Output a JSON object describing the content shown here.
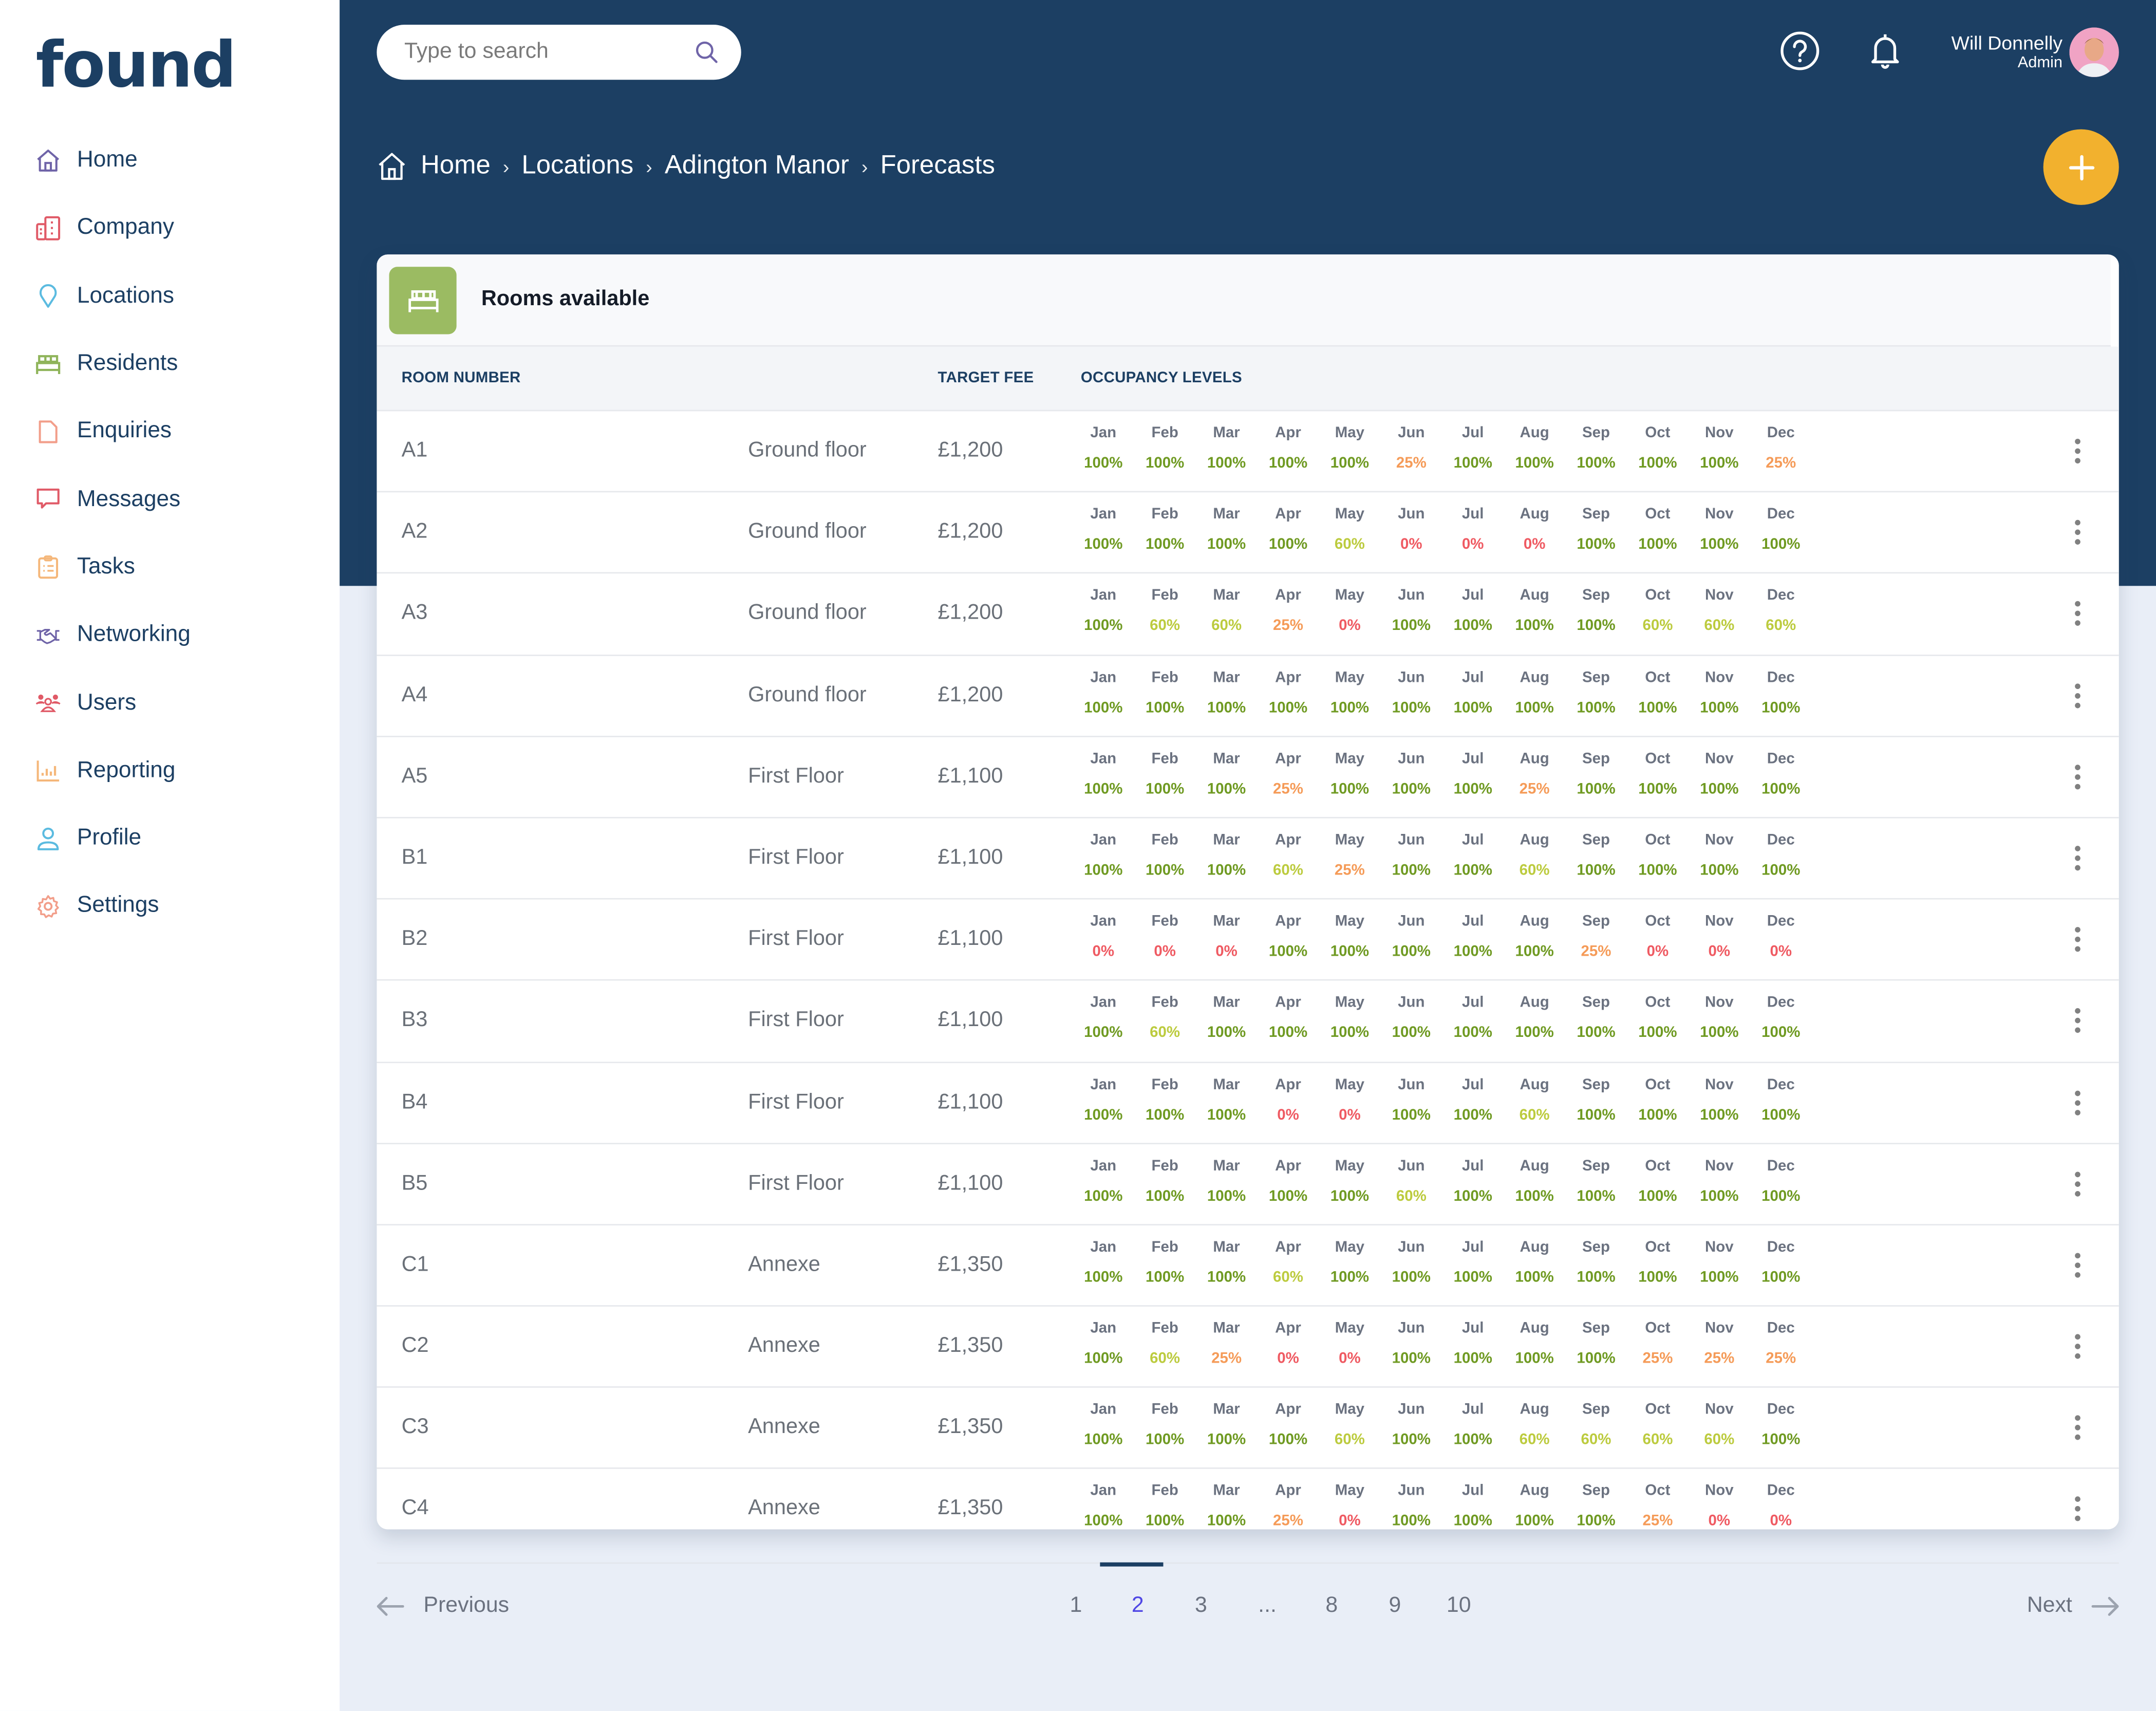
{
  "brand": {
    "logo": "found"
  },
  "sidebar": {
    "items": [
      {
        "label": "Home",
        "icon": "home-icon",
        "color": "#6f64a8"
      },
      {
        "label": "Company",
        "icon": "building-icon",
        "color": "#e05a67"
      },
      {
        "label": "Locations",
        "icon": "map-pin-icon",
        "color": "#5bbbe0"
      },
      {
        "label": "Residents",
        "icon": "bed-icon",
        "color": "#8fb45a"
      },
      {
        "label": "Enquiries",
        "icon": "document-icon",
        "color": "#f29e8a"
      },
      {
        "label": "Messages",
        "icon": "chat-icon",
        "color": "#e05a67"
      },
      {
        "label": "Tasks",
        "icon": "clipboard-icon",
        "color": "#f5b77a"
      },
      {
        "label": "Networking",
        "icon": "handshake-icon",
        "color": "#6f64a8"
      },
      {
        "label": "Users",
        "icon": "users-icon",
        "color": "#e05a67"
      },
      {
        "label": "Reporting",
        "icon": "bar-chart-icon",
        "color": "#f5b77a"
      },
      {
        "label": "Profile",
        "icon": "user-icon",
        "color": "#5bbbe0"
      },
      {
        "label": "Settings",
        "icon": "gear-icon",
        "color": "#f29e8a"
      }
    ]
  },
  "header": {
    "search_placeholder": "Type to search",
    "user_name": "Will Donnelly",
    "user_role": "Admin"
  },
  "breadcrumb": [
    "Home",
    "Locations",
    "Adington Manor",
    "Forecasts"
  ],
  "card": {
    "title": "Rooms available",
    "columns": {
      "room": "ROOM NUMBER",
      "fee": "TARGET FEE",
      "occupancy": "OCCUPANCY LEVELS"
    }
  },
  "months": [
    "Jan",
    "Feb",
    "Mar",
    "Apr",
    "May",
    "Jun",
    "Jul",
    "Aug",
    "Sep",
    "Oct",
    "Nov",
    "Dec"
  ],
  "level_colors": {
    "100%": "#6f9a22",
    "60%": "#bccb3e",
    "25%": "#f59b58",
    "0%": "#ef5a62"
  },
  "rooms": [
    {
      "room": "A1",
      "floor": "Ground floor",
      "fee": "£1,200",
      "occ": [
        "100%",
        "100%",
        "100%",
        "100%",
        "100%",
        "25%",
        "100%",
        "100%",
        "100%",
        "100%",
        "100%",
        "25%"
      ]
    },
    {
      "room": "A2",
      "floor": "Ground floor",
      "fee": "£1,200",
      "occ": [
        "100%",
        "100%",
        "100%",
        "100%",
        "60%",
        "0%",
        "0%",
        "0%",
        "100%",
        "100%",
        "100%",
        "100%"
      ]
    },
    {
      "room": "A3",
      "floor": "Ground floor",
      "fee": "£1,200",
      "occ": [
        "100%",
        "60%",
        "60%",
        "25%",
        "0%",
        "100%",
        "100%",
        "100%",
        "100%",
        "60%",
        "60%",
        "60%"
      ]
    },
    {
      "room": "A4",
      "floor": "Ground floor",
      "fee": "£1,200",
      "occ": [
        "100%",
        "100%",
        "100%",
        "100%",
        "100%",
        "100%",
        "100%",
        "100%",
        "100%",
        "100%",
        "100%",
        "100%"
      ]
    },
    {
      "room": "A5",
      "floor": "First Floor",
      "fee": "£1,100",
      "occ": [
        "100%",
        "100%",
        "100%",
        "25%",
        "100%",
        "100%",
        "100%",
        "25%",
        "100%",
        "100%",
        "100%",
        "100%"
      ]
    },
    {
      "room": "B1",
      "floor": "First Floor",
      "fee": "£1,100",
      "occ": [
        "100%",
        "100%",
        "100%",
        "60%",
        "25%",
        "100%",
        "100%",
        "60%",
        "100%",
        "100%",
        "100%",
        "100%"
      ]
    },
    {
      "room": "B2",
      "floor": "First Floor",
      "fee": "£1,100",
      "occ": [
        "0%",
        "0%",
        "0%",
        "100%",
        "100%",
        "100%",
        "100%",
        "100%",
        "25%",
        "0%",
        "0%",
        "0%"
      ]
    },
    {
      "room": "B3",
      "floor": "First Floor",
      "fee": "£1,100",
      "occ": [
        "100%",
        "60%",
        "100%",
        "100%",
        "100%",
        "100%",
        "100%",
        "100%",
        "100%",
        "100%",
        "100%",
        "100%"
      ]
    },
    {
      "room": "B4",
      "floor": "First Floor",
      "fee": "£1,100",
      "occ": [
        "100%",
        "100%",
        "100%",
        "0%",
        "0%",
        "100%",
        "100%",
        "60%",
        "100%",
        "100%",
        "100%",
        "100%"
      ]
    },
    {
      "room": "B5",
      "floor": "First Floor",
      "fee": "£1,100",
      "occ": [
        "100%",
        "100%",
        "100%",
        "100%",
        "100%",
        "60%",
        "100%",
        "100%",
        "100%",
        "100%",
        "100%",
        "100%"
      ]
    },
    {
      "room": "C1",
      "floor": "Annexe",
      "fee": "£1,350",
      "occ": [
        "100%",
        "100%",
        "100%",
        "60%",
        "100%",
        "100%",
        "100%",
        "100%",
        "100%",
        "100%",
        "100%",
        "100%"
      ]
    },
    {
      "room": "C2",
      "floor": "Annexe",
      "fee": "£1,350",
      "occ": [
        "100%",
        "60%",
        "25%",
        "0%",
        "0%",
        "100%",
        "100%",
        "100%",
        "100%",
        "25%",
        "25%",
        "25%"
      ]
    },
    {
      "room": "C3",
      "floor": "Annexe",
      "fee": "£1,350",
      "occ": [
        "100%",
        "100%",
        "100%",
        "100%",
        "60%",
        "100%",
        "100%",
        "60%",
        "60%",
        "60%",
        "60%",
        "100%"
      ]
    },
    {
      "room": "C4",
      "floor": "Annexe",
      "fee": "£1,350",
      "occ": [
        "100%",
        "100%",
        "100%",
        "25%",
        "0%",
        "100%",
        "100%",
        "100%",
        "100%",
        "25%",
        "0%",
        "0%"
      ]
    }
  ],
  "pagination": {
    "previous": "Previous",
    "next": "Next",
    "pages": [
      "1",
      "2",
      "3",
      "...",
      "8",
      "9",
      "10"
    ],
    "current": "2"
  }
}
